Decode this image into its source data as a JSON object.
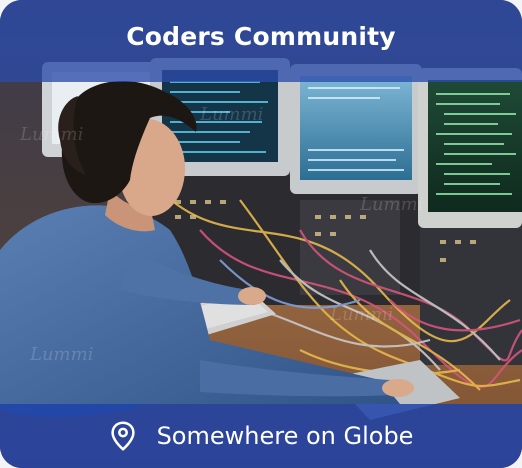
{
  "card": {
    "title": "Coders Community",
    "location": "Somewhere on Globe",
    "location_icon": "map-pin-icon",
    "overlay_color": "#2c4caa"
  },
  "photo": {
    "subject": "photo-programmer-at-computer-terminals",
    "watermark": "Lummi"
  }
}
